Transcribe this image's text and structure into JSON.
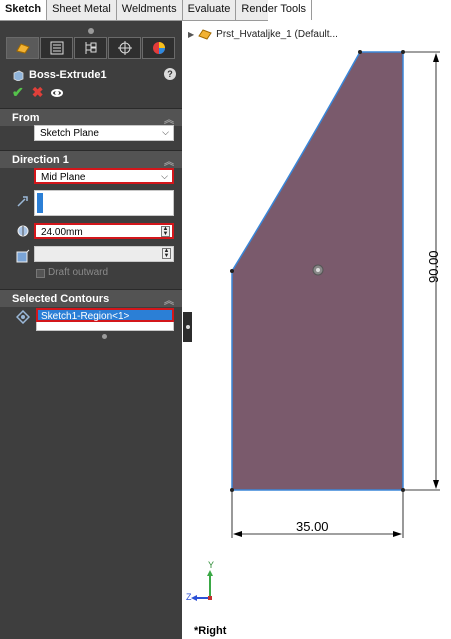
{
  "command_manager": {
    "tabs": [
      "Sketch",
      "Sheet Metal",
      "Weldments",
      "Evaluate",
      "Render Tools"
    ],
    "active_tab": "Sketch"
  },
  "property_manager": {
    "title": "Boss-Extrude1",
    "help": "?",
    "sections": {
      "from": {
        "header": "From",
        "value": "Sketch Plane"
      },
      "direction1": {
        "header": "Direction 1",
        "end_condition": "Mid Plane",
        "depth": "24.00mm",
        "draft_label": "Draft outward"
      },
      "selected_contours": {
        "header": "Selected Contours",
        "item": "Sketch1-Region<1>"
      }
    }
  },
  "feature_tree": {
    "part_name": "Prst_Hvataljke_1  (Default..."
  },
  "viewport": {
    "dimension_height": "90.00",
    "dimension_width": "35.00",
    "view_name": "*Right",
    "triad_y": "Y",
    "triad_z": "Z"
  },
  "colors": {
    "panel_bg": "#3e3e3e",
    "section_header": "#535353",
    "selection_blue": "#2b7fd6",
    "highlight_red": "#d3161b",
    "part_fill": "#7a5a6c",
    "edge_blue": "#3a86d8"
  }
}
